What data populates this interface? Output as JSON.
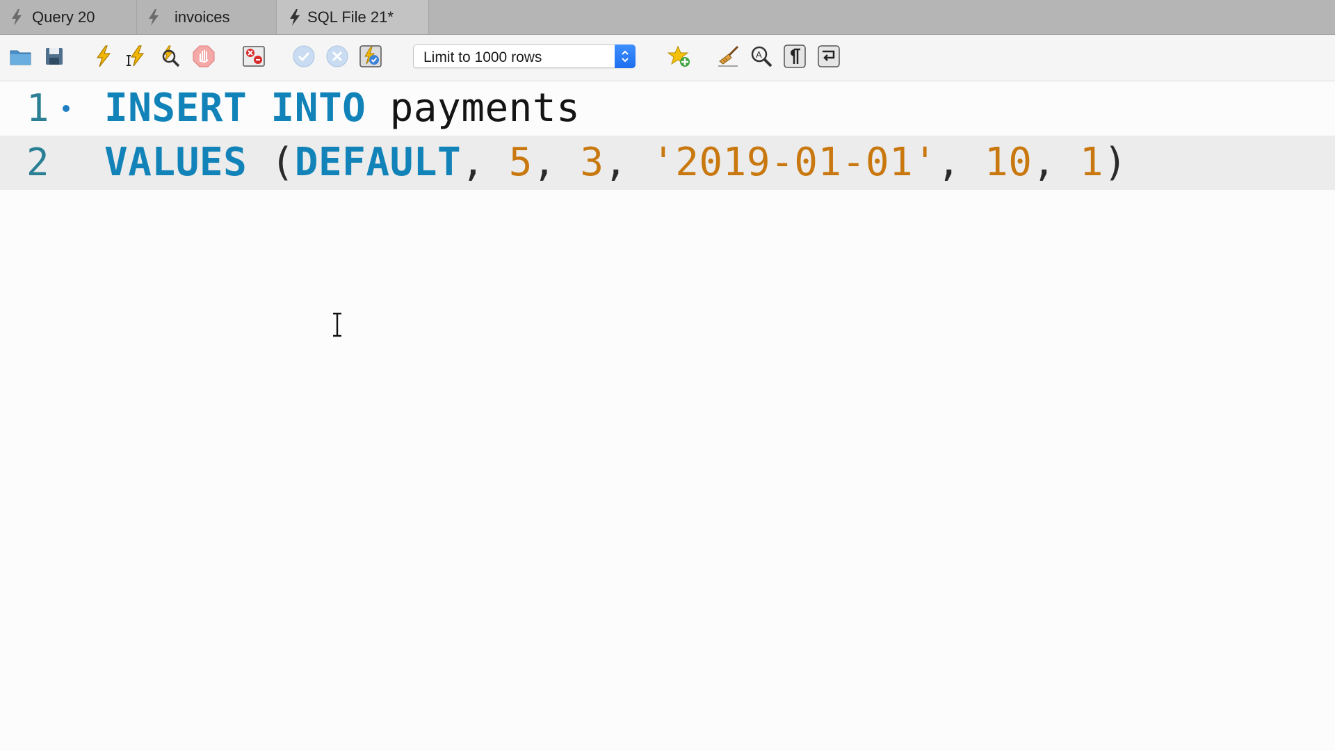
{
  "tabs": [
    {
      "label": "Query 20",
      "active": false
    },
    {
      "label": "invoices",
      "active": false
    },
    {
      "label": "SQL File 21*",
      "active": true
    }
  ],
  "toolbar": {
    "limit_select": {
      "value": "Limit to 1000 rows"
    },
    "icons": [
      "open-folder-icon",
      "save-icon",
      "execute-icon",
      "execute-current-icon",
      "explain-icon",
      "stop-icon",
      "toggle-error-icon",
      "commit-icon",
      "rollback-icon",
      "autocommit-icon",
      "add-snippet-icon",
      "beautify-icon",
      "find-icon",
      "invisible-chars-icon",
      "wrap-lines-icon"
    ]
  },
  "editor": {
    "lines": [
      {
        "number": "1",
        "has_marker": true,
        "tokens": [
          {
            "type": "kw",
            "text": "INSERT"
          },
          {
            "type": "ws",
            "text": " "
          },
          {
            "type": "kw",
            "text": "INTO"
          },
          {
            "type": "ws",
            "text": " "
          },
          {
            "type": "id",
            "text": "payments"
          }
        ]
      },
      {
        "number": "2",
        "has_marker": false,
        "tokens": [
          {
            "type": "kw",
            "text": "VALUES"
          },
          {
            "type": "ws",
            "text": " "
          },
          {
            "type": "punc",
            "text": "("
          },
          {
            "type": "kw",
            "text": "DEFAULT"
          },
          {
            "type": "punc",
            "text": ", "
          },
          {
            "type": "num",
            "text": "5"
          },
          {
            "type": "punc",
            "text": ", "
          },
          {
            "type": "num",
            "text": "3"
          },
          {
            "type": "punc",
            "text": ", "
          },
          {
            "type": "str",
            "text": "'2019-01-01'"
          },
          {
            "type": "punc",
            "text": ", "
          },
          {
            "type": "num",
            "text": "10"
          },
          {
            "type": "punc",
            "text": ", "
          },
          {
            "type": "num",
            "text": "1"
          },
          {
            "type": "punc",
            "text": ")"
          }
        ]
      }
    ]
  },
  "colors": {
    "keyword": "#1283b8",
    "number": "#c8780e",
    "string": "#c8780e",
    "gutter": "#2a7f95",
    "current_line": "#ececec"
  }
}
